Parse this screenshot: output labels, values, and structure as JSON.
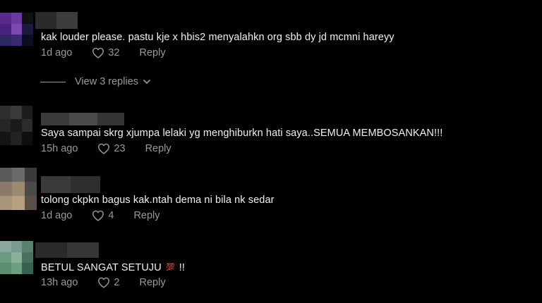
{
  "comments": [
    {
      "text": "kak louder please. pastu kje x hbis2 menyalahkn org sbb dy jd mcmni hareyy",
      "time": "1d ago",
      "likes": "32",
      "reply": "Reply",
      "view_replies": "View 3 replies"
    },
    {
      "text": "Saya sampai skrg xjumpa lelaki yg menghiburkn hati saya..SEMUA MEMBOSANKAN!!!",
      "time": "15h ago",
      "likes": "23",
      "reply": "Reply"
    },
    {
      "text": "tolong ckpkn bagus kak.ntah dema ni bila nk sedar",
      "time": "1d ago",
      "likes": "4",
      "reply": "Reply"
    },
    {
      "text_before": "BETUL SANGAT SETUJU",
      "emoji": "💯",
      "text_after": "!!",
      "time": "13h ago",
      "likes": "2",
      "reply": "Reply"
    }
  ],
  "icons": {
    "like": "heart-icon",
    "expand": "chevron-down-icon",
    "emoji": "hundred-points-emoji"
  },
  "colors": {
    "background": "#000000",
    "text": "#f2f2f2",
    "muted": "#9a9a9a"
  }
}
